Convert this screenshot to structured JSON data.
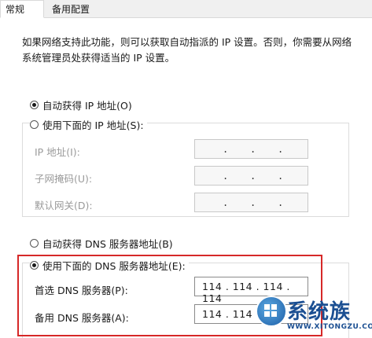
{
  "tabs": [
    {
      "label": "常规",
      "active": true
    },
    {
      "label": "备用配置",
      "active": false
    }
  ],
  "description": "如果网络支持此功能，则可以获取自动指派的 IP 设置。否则，你需要从网络系统管理员处获得适当的 IP 设置。",
  "ip": {
    "auto_label": "自动获得 IP 地址(O)",
    "auto_selected": true,
    "manual_label": "使用下面的 IP 地址(S):",
    "manual_selected": false,
    "fields": [
      {
        "label": "IP 地址(I):",
        "value": ""
      },
      {
        "label": "子网掩码(U):",
        "value": ""
      },
      {
        "label": "默认网关(D):",
        "value": ""
      }
    ]
  },
  "dns": {
    "auto_label": "自动获得 DNS 服务器地址(B)",
    "auto_selected": false,
    "manual_label": "使用下面的 DNS 服务器地址(E):",
    "manual_selected": true,
    "fields": [
      {
        "label": "首选 DNS 服务器(P):",
        "value": "114 . 114 . 114 . 114"
      },
      {
        "label": "备用 DNS 服务器(A):",
        "value": "114 . 114 . 1"
      }
    ]
  },
  "watermark": {
    "text": "系统族",
    "url": "WWW.XITONGZU.COM"
  },
  "colors": {
    "highlight_border": "#d62828",
    "watermark": "#1b4f92"
  }
}
